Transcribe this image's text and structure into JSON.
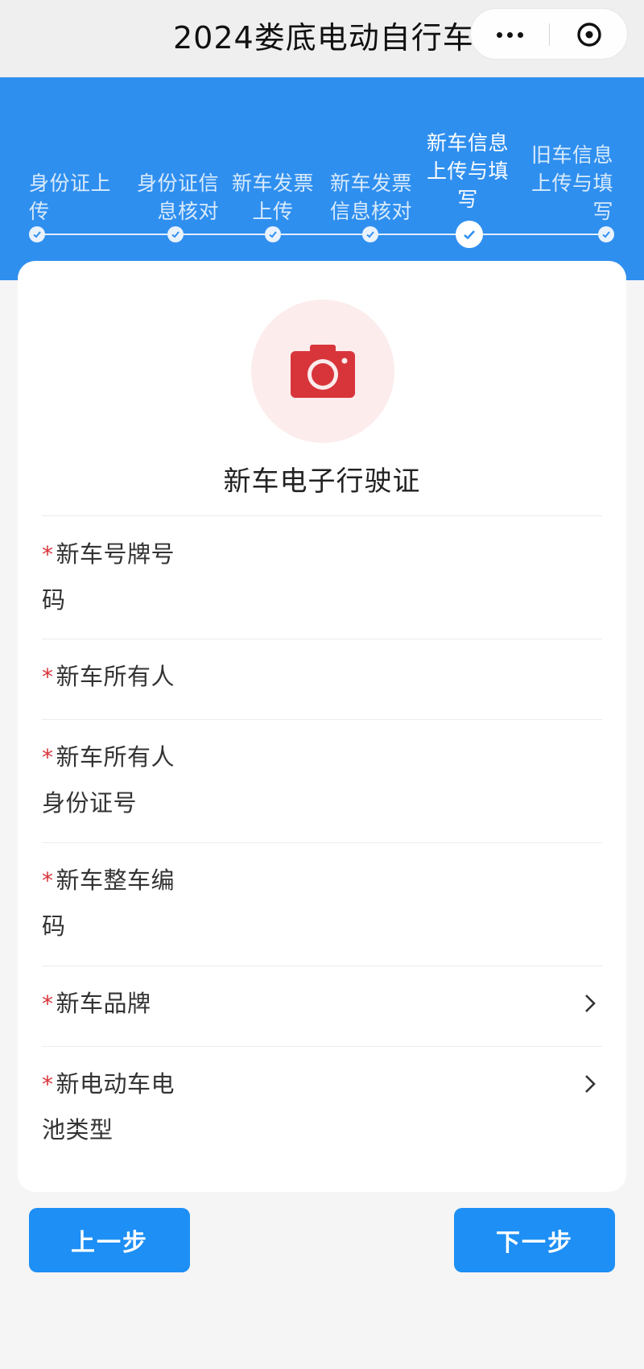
{
  "nav": {
    "title": "2024娄底电动自行车",
    "more_icon": "more-dots-icon",
    "close_icon": "close-circle-icon"
  },
  "steps": [
    {
      "label": "身份证上传",
      "state": "done"
    },
    {
      "label": "身份证信息核对",
      "state": "done"
    },
    {
      "label": "新车发票上传",
      "state": "done"
    },
    {
      "label": "新车发票信息核对",
      "state": "done"
    },
    {
      "label": "新车信息上传与填写",
      "state": "current"
    },
    {
      "label": "旧车信息上传与填写",
      "state": "pending"
    }
  ],
  "upload": {
    "icon": "camera-icon",
    "title": "新车电子行驶证"
  },
  "form": {
    "required_mark": "*",
    "fields": [
      {
        "label": "新车号牌号码",
        "value": ""
      },
      {
        "label": "新车所有人",
        "value": ""
      },
      {
        "label": "新车所有人身份证号",
        "value": ""
      },
      {
        "label": "新车整车编码",
        "value": ""
      },
      {
        "label": "新车品牌",
        "value": "",
        "selectable": true
      },
      {
        "label": "新电动车电池类型",
        "value": "",
        "selectable": true
      }
    ]
  },
  "buttons": {
    "prev": "上一步",
    "next": "下一步"
  },
  "colors": {
    "primary": "#2f8fef",
    "button": "#1d8ff5",
    "required": "#d8353b",
    "camera": "#d8353b",
    "camera_bg": "#fcecec",
    "page_bg": "#f5f5f5"
  }
}
